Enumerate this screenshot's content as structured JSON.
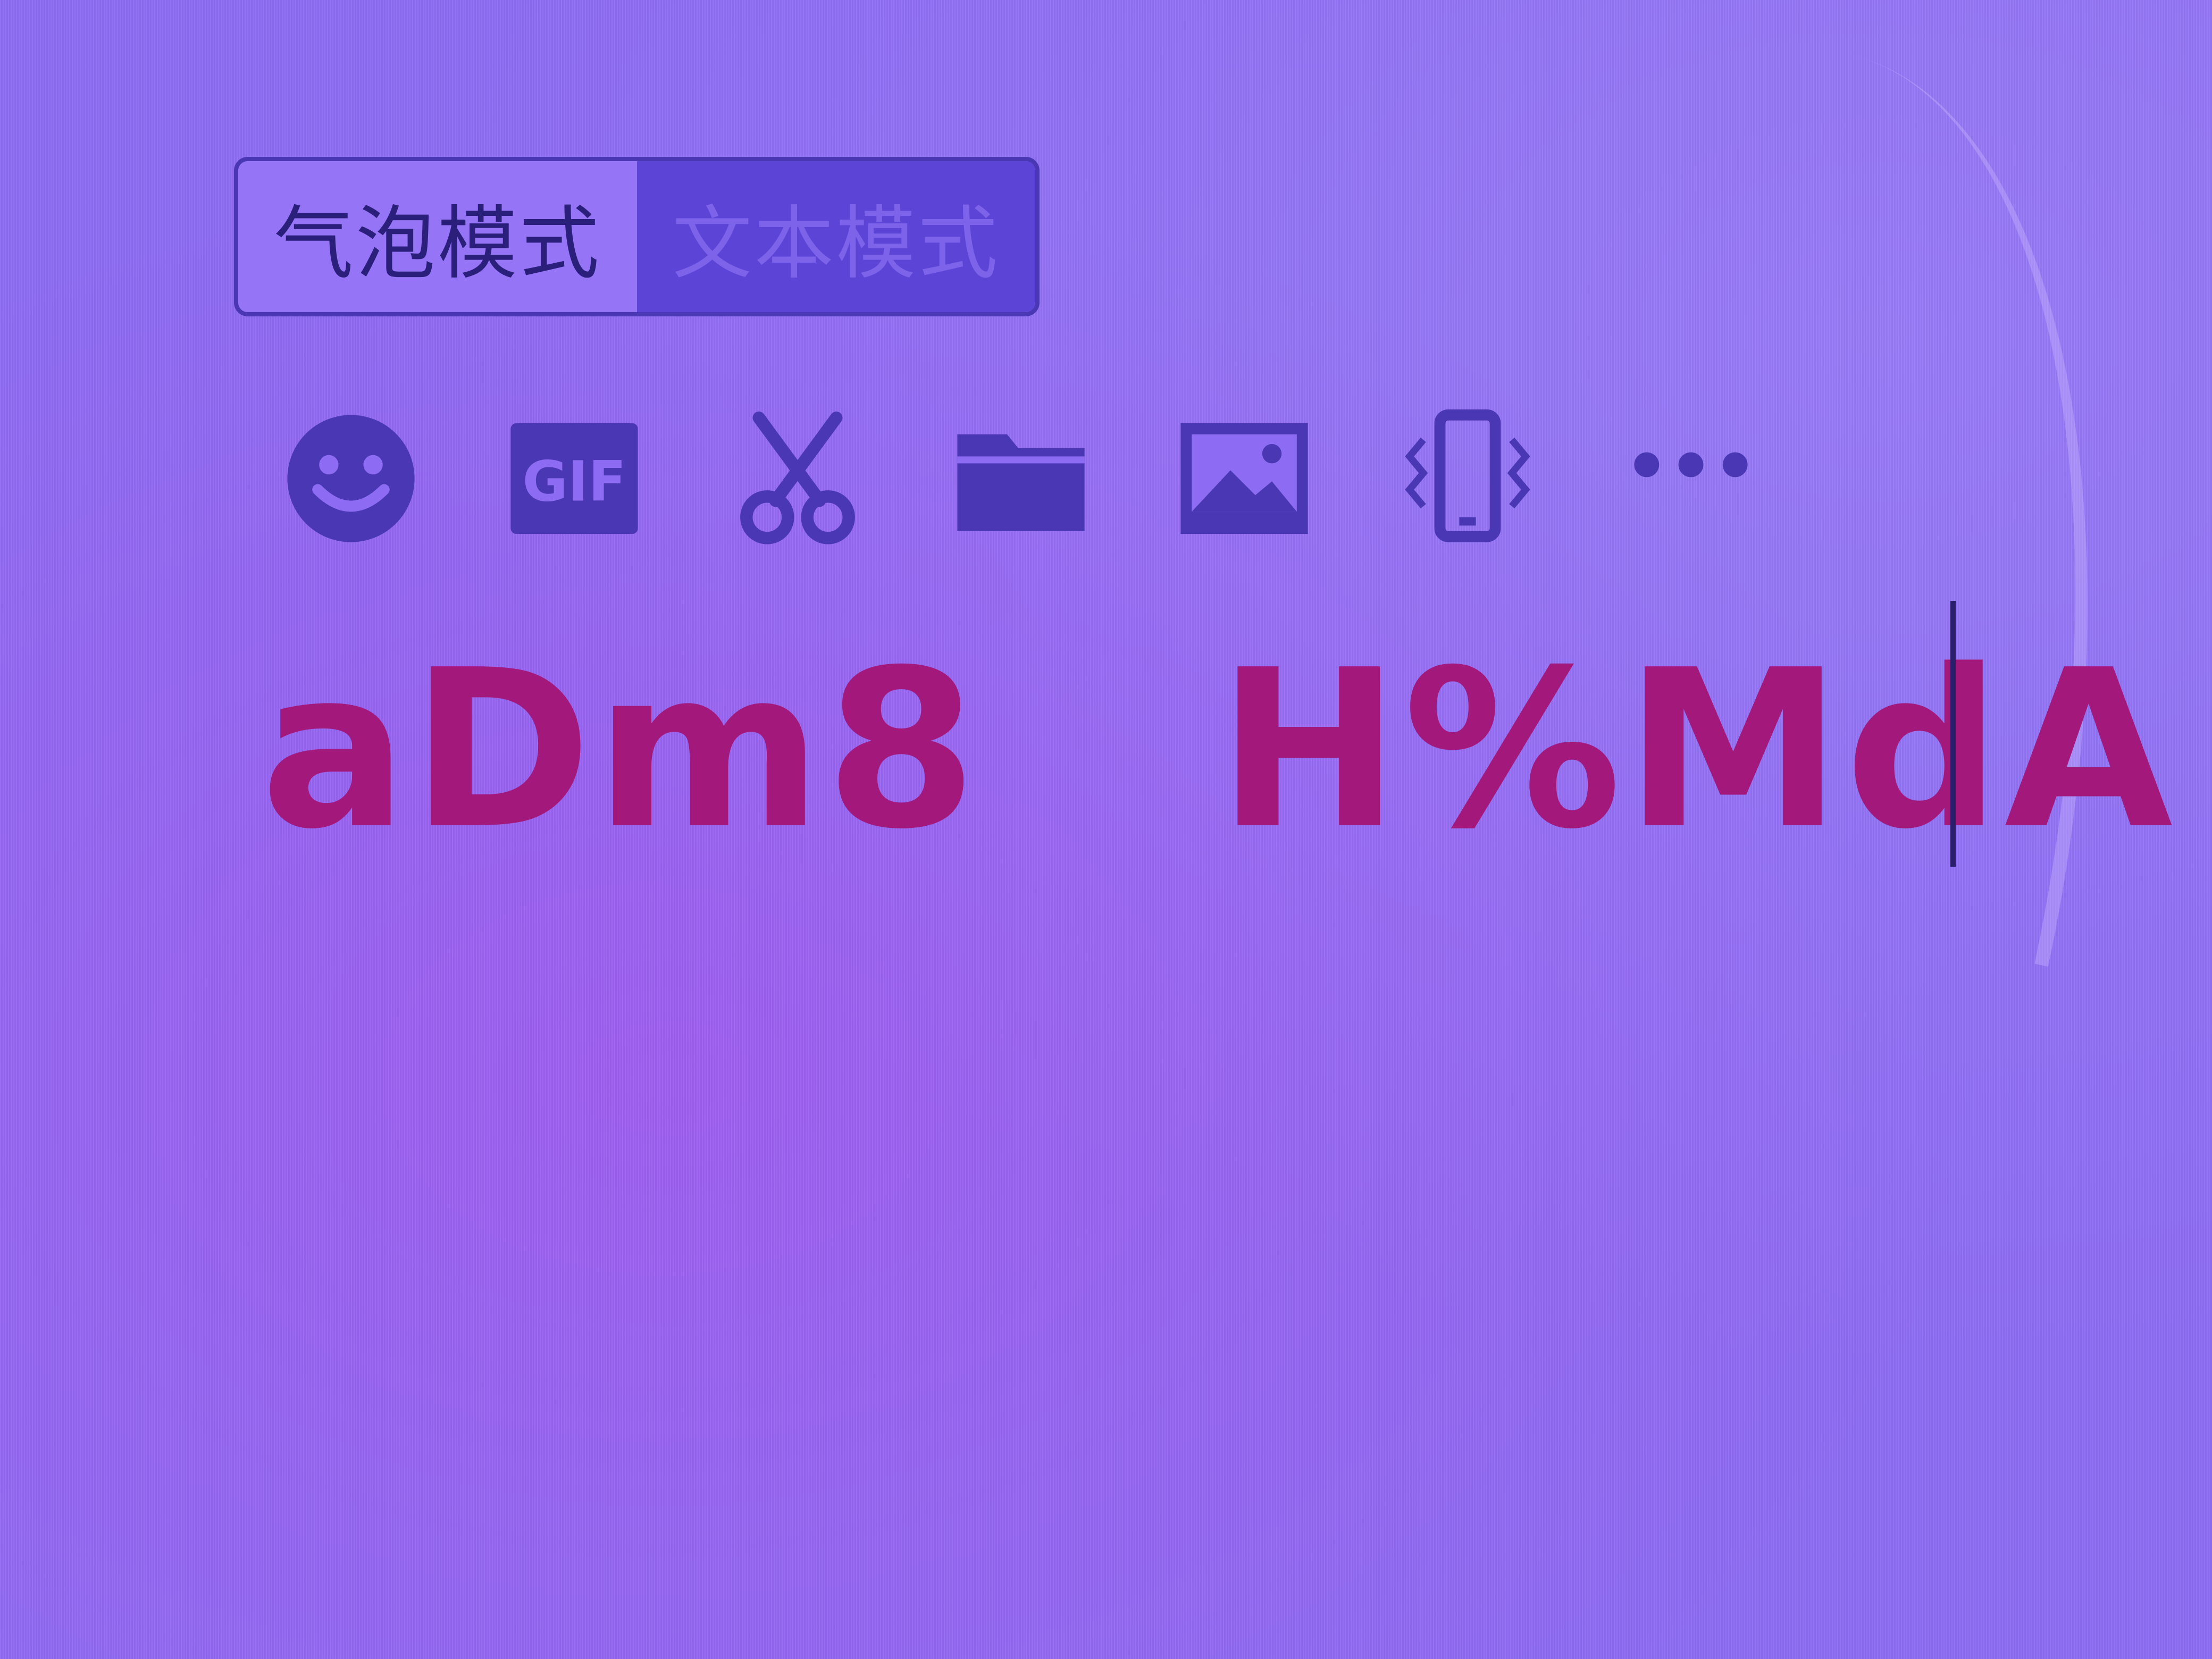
{
  "mode_toggle": {
    "bubble_mode_label": "气泡模式",
    "text_mode_label": "文本模式",
    "selected": "text_mode"
  },
  "toolbar": {
    "items": [
      {
        "name": "emoji",
        "icon": "smiley-icon"
      },
      {
        "name": "gif",
        "icon": "gif-icon",
        "label": "GIF"
      },
      {
        "name": "screenshot",
        "icon": "scissors-icon"
      },
      {
        "name": "file",
        "icon": "folder-icon"
      },
      {
        "name": "image",
        "icon": "image-icon"
      },
      {
        "name": "shake",
        "icon": "phone-vibrate-icon"
      },
      {
        "name": "more",
        "icon": "more-icon"
      }
    ]
  },
  "editor": {
    "text": "aDm8   H%MdA",
    "text_color": "#a3187b"
  },
  "colors": {
    "background": "#8d6cf3",
    "icon": "#4a37b3",
    "active_tab": "#5c44d6"
  }
}
